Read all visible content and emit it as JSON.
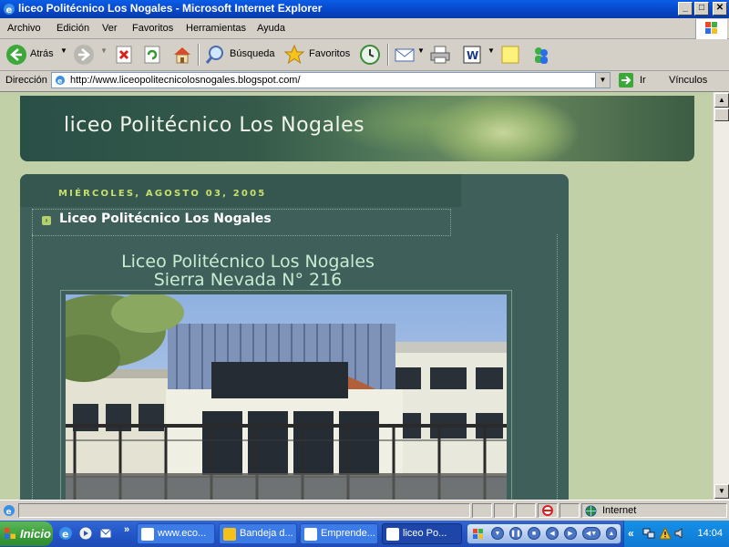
{
  "window": {
    "title": "liceo Politécnico Los Nogales - Microsoft Internet Explorer",
    "buttons": {
      "minimize": "_",
      "maximize": "□",
      "close": "✕"
    }
  },
  "menu": {
    "items": [
      "Archivo",
      "Edición",
      "Ver",
      "Favoritos",
      "Herramientas",
      "Ayuda"
    ]
  },
  "toolbar": {
    "back_label": "Atrás",
    "search_label": "Búsqueda",
    "favorites_label": "Favoritos"
  },
  "address": {
    "label": "Dirección",
    "url": "http://www.liceopolitecnicolosnogales.blogspot.com/",
    "go_label": "Ir",
    "links_label": "Vínculos"
  },
  "blog": {
    "title": "liceo Politécnico Los Nogales",
    "date_header": "MIÉRCOLES, AGOSTO 03, 2005",
    "post_title": "Liceo Politécnico Los Nogales",
    "post_line1": "Liceo Politécnico Los Nogales",
    "post_line2": "Sierra Nevada N° 216"
  },
  "status": {
    "zone": "Internet"
  },
  "taskbar": {
    "start_label": "Inicio",
    "tasks": [
      "www.eco...",
      "Bandeja d...",
      "Emprende...",
      "liceo Po..."
    ],
    "clock": "14:04"
  },
  "colors": {
    "page_bg": "#c2d0a8",
    "panel_bg": "#3f5f5a",
    "date_color": "#c8e06b",
    "title_bar": "#0846c8"
  }
}
